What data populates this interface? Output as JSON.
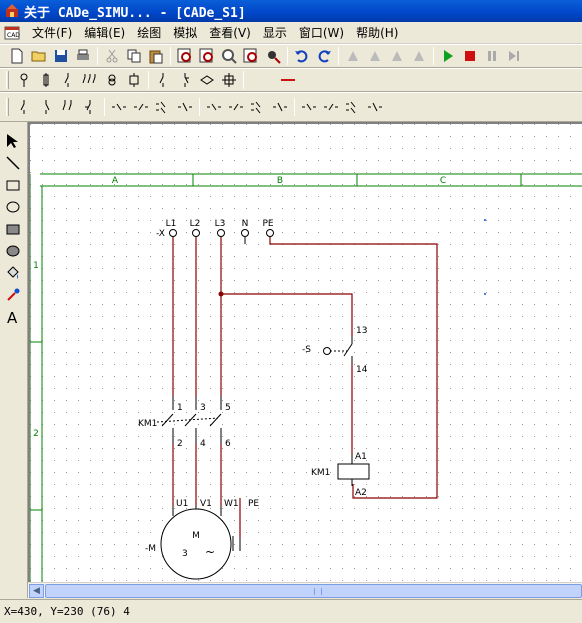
{
  "window": {
    "title": "关于 CADe_SIMU... - [CADe_S1]"
  },
  "menu": [
    "文件(F)",
    "编辑(E)",
    "绘图",
    "模拟",
    "查看(V)",
    "显示",
    "窗口(W)",
    "帮助(H)"
  ],
  "status": {
    "text": "X=430, Y=230 (76) 4"
  },
  "ruler": {
    "columns": [
      "A",
      "B",
      "C"
    ],
    "rows": [
      "1",
      "2"
    ]
  },
  "schematic": {
    "terminal_prefix": "-X",
    "terminals": [
      "L1",
      "L2",
      "L3",
      "N",
      "PE"
    ],
    "switch_label": "-S",
    "switch_pins": [
      "13",
      "14"
    ],
    "contactor_label": "KM1",
    "contactor_top_pins": [
      "1",
      "3",
      "5"
    ],
    "contactor_bottom_pins": [
      "2",
      "4",
      "6"
    ],
    "coil_label": "KM1",
    "coil_pins": [
      "A1",
      "A2"
    ],
    "motor_terminals": [
      "U1",
      "V1",
      "W1",
      "PE"
    ],
    "motor_label": "-M",
    "motor_letter": "M",
    "motor_phases": "3",
    "motor_symbol": "~"
  },
  "colors": {
    "wire": "#8b0000",
    "component": "#000000",
    "frame": "#008000",
    "junction": "#8b0000"
  }
}
